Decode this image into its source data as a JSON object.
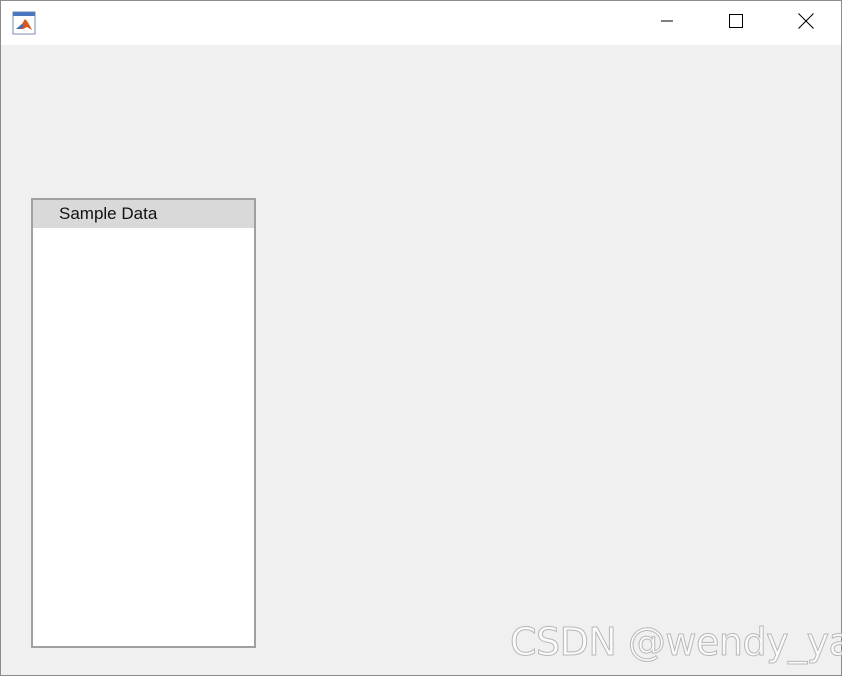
{
  "window": {
    "title": "",
    "app_icon": "matlab-logo-icon",
    "controls": {
      "minimize_icon": "minimize-icon",
      "maximize_icon": "maximize-icon",
      "close_icon": "close-icon"
    }
  },
  "listbox": {
    "items": [
      {
        "label": "Sample Data",
        "selected": true
      }
    ]
  },
  "watermark": {
    "text": "CSDN @wendy_ya"
  },
  "colors": {
    "background": "#f0f0f0",
    "titlebar": "#ffffff",
    "listbox_background": "#ffffff",
    "selected_item": "#d9d9d9",
    "border": "#a0a0a0"
  }
}
